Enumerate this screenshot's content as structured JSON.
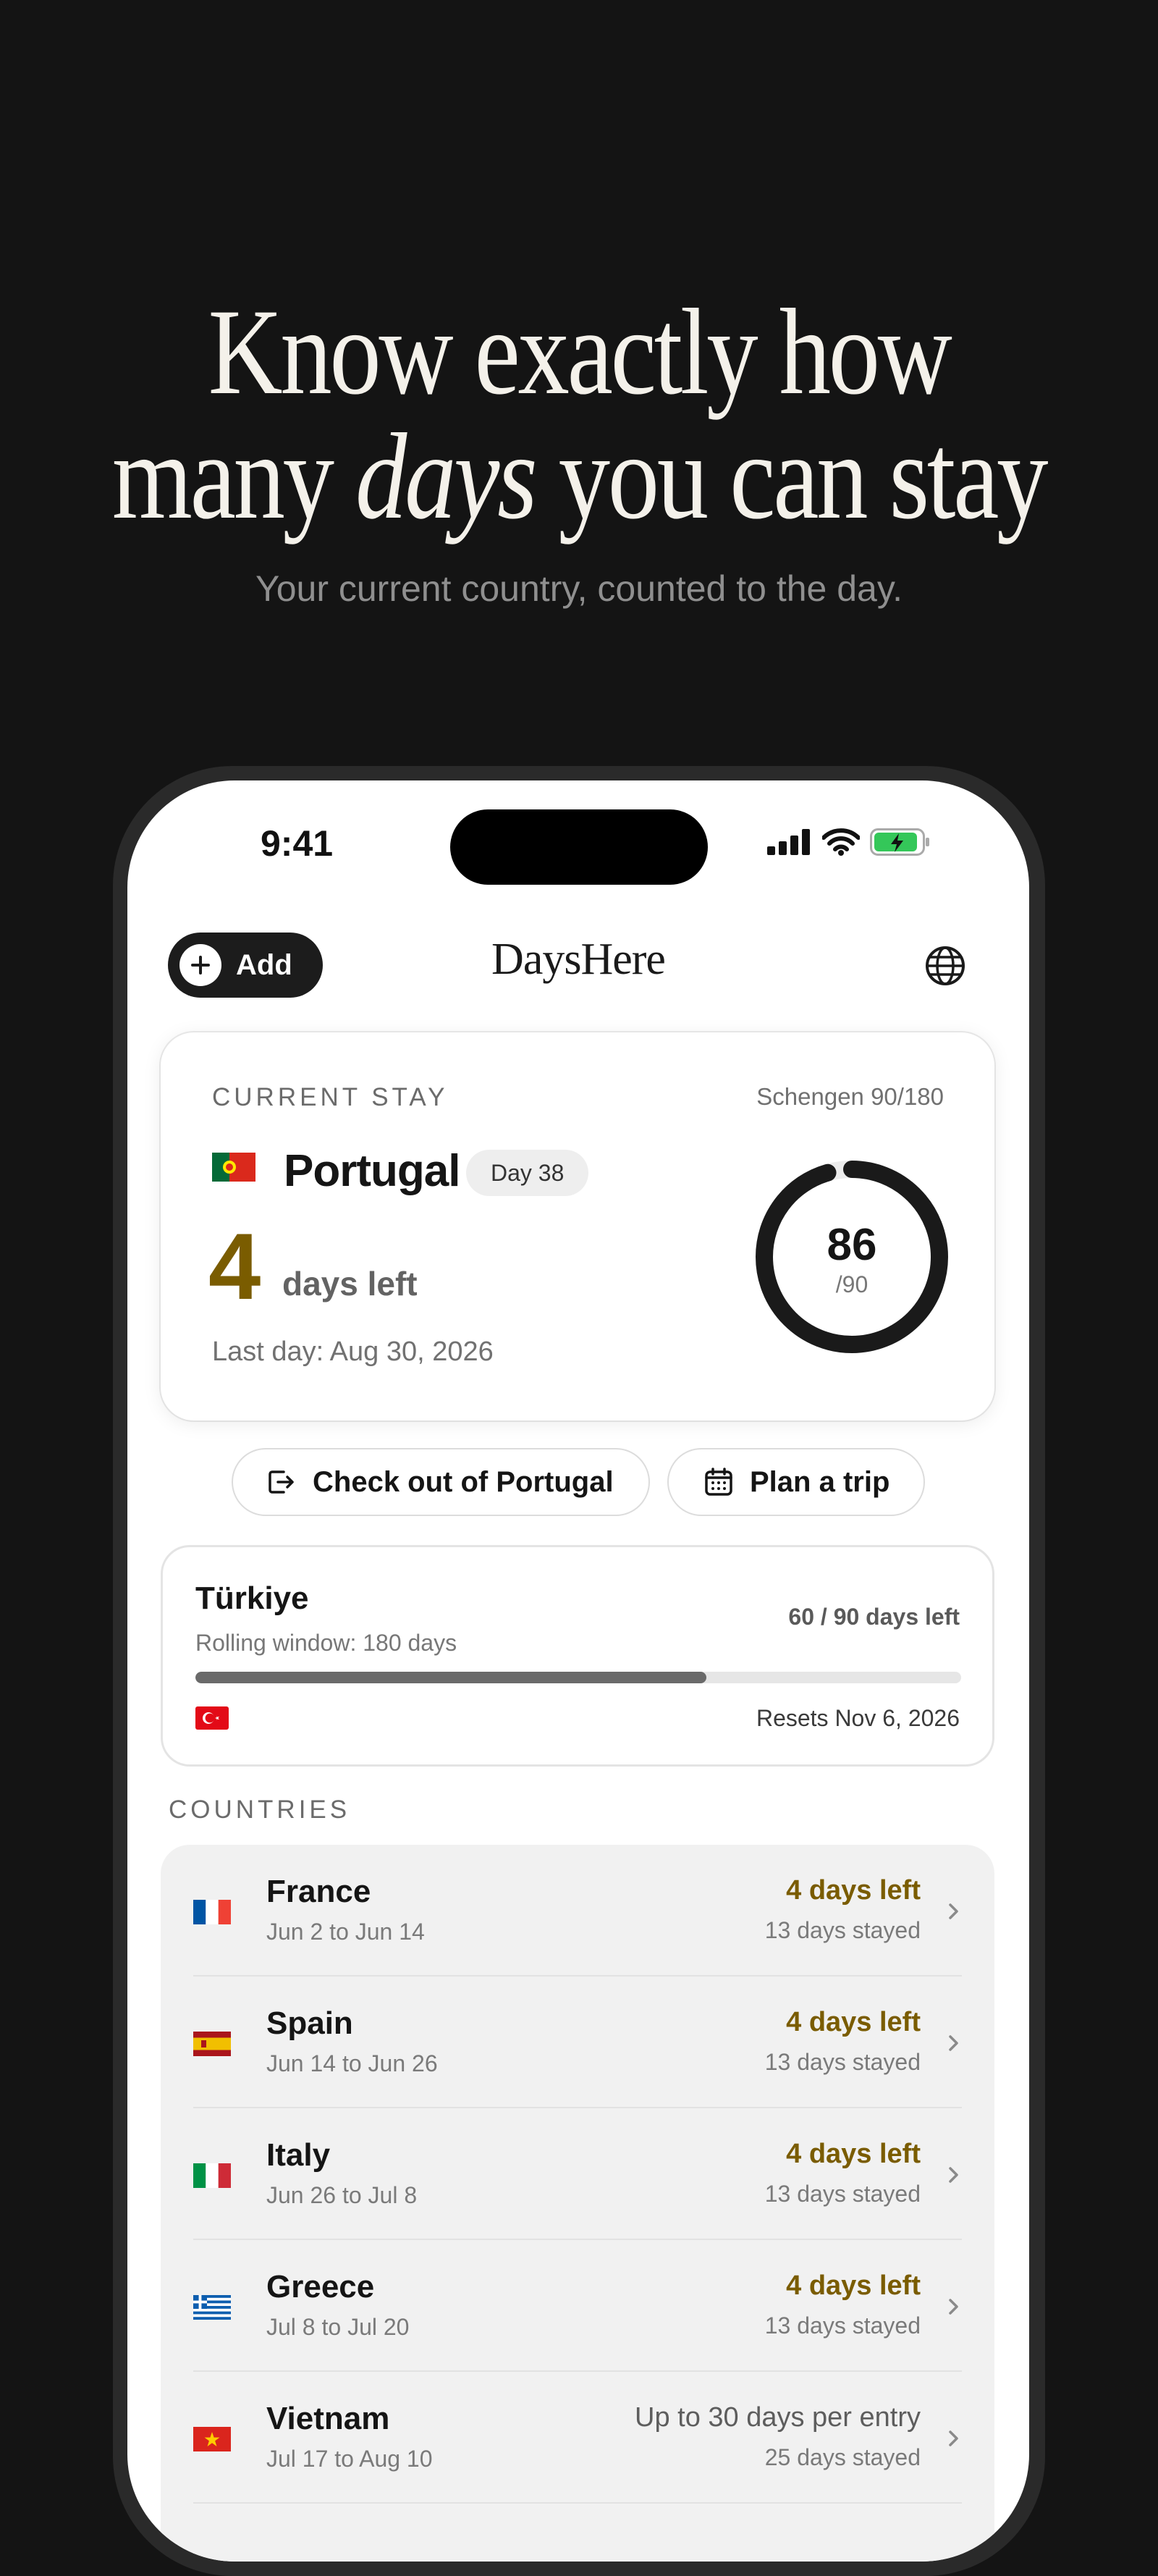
{
  "hero": {
    "title_line1": "Know exactly how",
    "title_line2_pre": "many ",
    "title_line2_em": "days",
    "title_line2_post": " you can stay",
    "subtitle": "Your current country, counted to the day."
  },
  "status_bar": {
    "time": "9:41"
  },
  "header": {
    "add_label": "Add",
    "app_title": "DaysHere"
  },
  "current_stay": {
    "section_label": "CURRENT STAY",
    "scheme": "Schengen 90/180",
    "country": "Portugal",
    "day_badge": "Day 38",
    "days_left_number": "4",
    "days_left_label": "days left",
    "last_day": "Last day: Aug 30, 2026",
    "ring_value": "86",
    "ring_total": "/90",
    "ring_fraction": 0.955
  },
  "actions": {
    "checkout_label": "Check out of Portugal",
    "plan_label": "Plan a trip"
  },
  "turkiye": {
    "name": "Türkiye",
    "window": "Rolling window: 180 days",
    "days_left": "60 / 90 days left",
    "progress": 0.667,
    "resets": "Resets Nov 6, 2026"
  },
  "countries": {
    "section_label": "COUNTRIES",
    "items": [
      {
        "name": "France",
        "dates": "Jun 2 to Jun 14",
        "status": "4 days left",
        "stayed": "13 days stayed",
        "flag": "france"
      },
      {
        "name": "Spain",
        "dates": "Jun 14 to Jun 26",
        "status": "4 days left",
        "stayed": "13 days stayed",
        "flag": "spain"
      },
      {
        "name": "Italy",
        "dates": "Jun 26 to Jul 8",
        "status": "4 days left",
        "stayed": "13 days stayed",
        "flag": "italy"
      },
      {
        "name": "Greece",
        "dates": "Jul 8 to Jul 20",
        "status": "4 days left",
        "stayed": "13 days stayed",
        "flag": "greece"
      },
      {
        "name": "Vietnam",
        "dates": "Jul 17 to Aug 10",
        "status": "Up to 30 days per entry",
        "stayed": "25 days stayed",
        "flag": "vietnam"
      }
    ]
  },
  "colors": {
    "accent_gold": "#7a5c00",
    "background": "#141414",
    "battery_green": "#34c759"
  }
}
